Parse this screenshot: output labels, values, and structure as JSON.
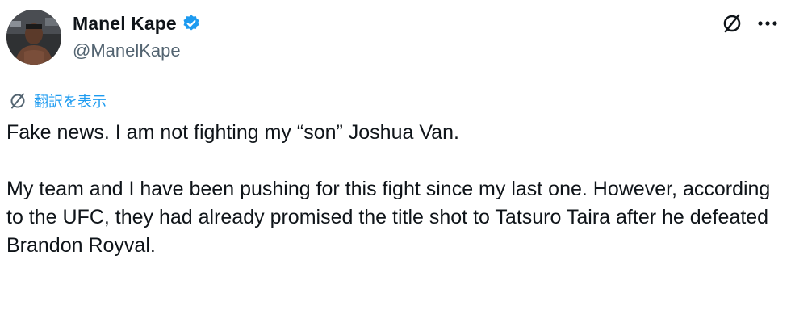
{
  "post": {
    "author": {
      "display_name": "Manel Kape",
      "handle": "@ManelKape",
      "verified": true
    },
    "translate_label": "翻訳を表示",
    "paragraphs": [
      "Fake news. I am not fighting my “son” Joshua Van.",
      "My team and I have been pushing for this fight since my last one. However, according to the UFC, they had already promised the title shot to Tatsuro Taira after he defeated Brandon Royval."
    ]
  },
  "icons": {
    "verified": "verified-badge-icon",
    "grok": "grok-icon",
    "more": "more-options-icon",
    "translate": "translate-icon"
  },
  "colors": {
    "text": "#0f1419",
    "secondary": "#536471",
    "accent": "#1d9bf0"
  }
}
